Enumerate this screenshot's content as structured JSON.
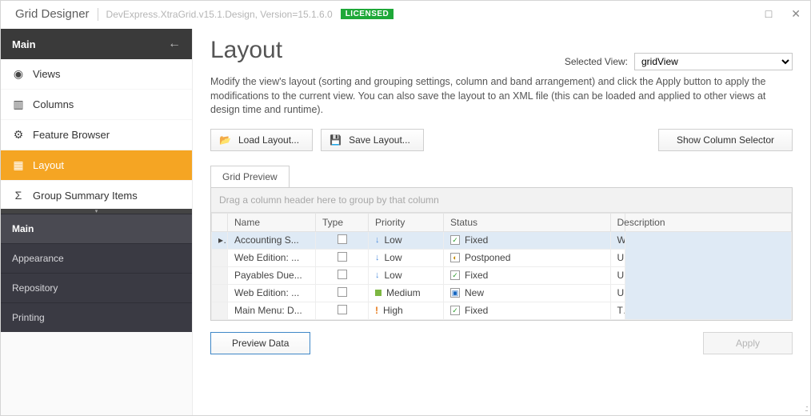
{
  "window": {
    "title": "Grid Designer",
    "assembly": "DevExpress.XtraGrid.v15.1.Design, Version=15.1.6.0",
    "badge": "LICENSED"
  },
  "sidebar": {
    "header": "Main",
    "items": [
      {
        "icon": "eye",
        "label": "Views"
      },
      {
        "icon": "cols",
        "label": "Columns"
      },
      {
        "icon": "gear",
        "label": "Feature Browser"
      },
      {
        "icon": "layout",
        "label": "Layout"
      },
      {
        "icon": "sigma",
        "label": "Group Summary Items"
      }
    ],
    "groups": [
      "Main",
      "Appearance",
      "Repository",
      "Printing"
    ]
  },
  "page": {
    "heading": "Layout",
    "selected_view_label": "Selected View:",
    "selected_view_value": "gridView",
    "description": "Modify the view's layout (sorting and grouping settings, column and band arrangement) and click the Apply button to apply the modifications to the current view. You can also save the layout to an XML file (this can be loaded and applied to other views at design time and runtime).",
    "toolbar": {
      "load": "Load Layout...",
      "save": "Save Layout...",
      "colsel": "Show Column Selector"
    },
    "tab": "Grid Preview",
    "group_bar": "Drag a column header here to group by that column",
    "columns": [
      "Name",
      "Type",
      "Priority",
      "Status",
      "Description"
    ],
    "rows": [
      {
        "name": "Accounting S...",
        "priority": "Low",
        "pri_icon": "down",
        "status": "Fixed",
        "st_icon": "fixed",
        "desc": "When entering a new transaction into the Accounting system, ..."
      },
      {
        "name": "Web Edition: ...",
        "priority": "Low",
        "pri_icon": "down",
        "status": "Postponed",
        "st_icon": "post",
        "desc": "Unable to enter data into the web edition of the Accounting Sy..."
      },
      {
        "name": "Payables Due...",
        "priority": "Low",
        "pri_icon": "down",
        "status": "Fixed",
        "st_icon": "fixed",
        "desc": "Unable to calculate payables due."
      },
      {
        "name": "Web Edition: ...",
        "priority": "Medium",
        "pri_icon": "med",
        "status": "New",
        "st_icon": "new",
        "desc": "Unable to search for transactions via the search page. Date pa..."
      },
      {
        "name": "Main Menu: D...",
        "priority": "High",
        "pri_icon": "high",
        "status": "Fixed",
        "st_icon": "fixed",
        "desc": "There are duplicate items in the main menu."
      }
    ],
    "footer": {
      "preview": "Preview Data",
      "apply": "Apply"
    }
  }
}
